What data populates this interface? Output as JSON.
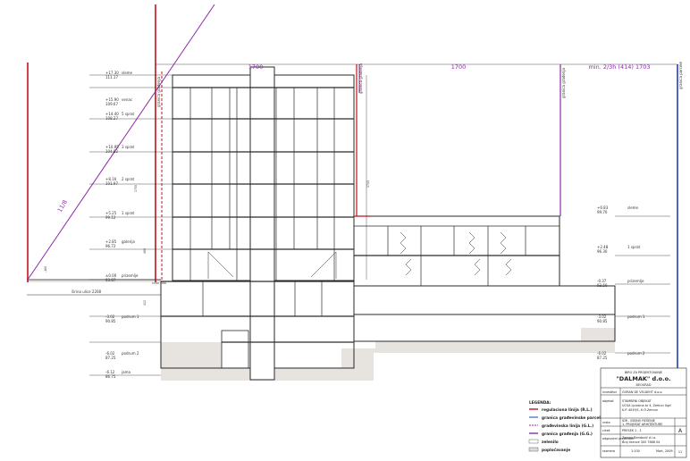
{
  "colors": {
    "line": "#2a2a2a",
    "red": "#c1121f",
    "purple": "#8e2aa8",
    "magenta": "#b0208a",
    "blue": "#1f3fb5",
    "ground": "#e7e3de",
    "grid": "#d9d9d9"
  },
  "dimensions": {
    "top_left": "1700",
    "top_right": "1700",
    "top_far_right": "min. 2/3h (414)  1703",
    "diagonal_left": "11/8",
    "street_width": "širina ulice 2208"
  },
  "vertical_labels": {
    "granica_gradjenja_left": "granica građenja",
    "granica_gradjenja_right": "granica građenja",
    "granica_parcele": "granica parcele",
    "height_1": "1750",
    "height_2": "1745"
  },
  "levels_left": [
    {
      "elev": "+17.30",
      "abs": "111.17",
      "name": "sleme"
    },
    {
      "elev": "+15.90",
      "abs": "109.67",
      "name": "venac"
    },
    {
      "elev": "+14.40",
      "abs": "108.27",
      "name": "5 sprat"
    },
    {
      "elev": "+10.95",
      "abs": "104.82",
      "name": "3 sprat"
    },
    {
      "elev": "+8.16",
      "abs": "101.97",
      "name": "2 sprat"
    },
    {
      "elev": "+5.25",
      "abs": "99.12",
      "name": "1 sprat"
    },
    {
      "elev": "+2.85",
      "abs": "96.72",
      "name": "galerija"
    },
    {
      "elev": "±0.00",
      "abs": "93.87",
      "name": "prizemlje"
    },
    {
      "elev": "-3.02",
      "abs": "90.85",
      "name": "podrum 1"
    },
    {
      "elev": "-6.02",
      "abs": "87.25",
      "name": "podrum 2"
    },
    {
      "elev": "-6.12",
      "abs": "86.75",
      "name": "jama"
    }
  ],
  "levels_right": [
    {
      "elev": "+6.83",
      "abs": "99.70",
      "name": "sleme"
    },
    {
      "elev": "+2.48",
      "abs": "96.30",
      "name": "1 sprat"
    },
    {
      "elev": "-0.37",
      "abs": "93.50",
      "name": "prizemlje"
    },
    {
      "elev": "-3.02",
      "abs": "90.85",
      "name": "podrum 1"
    },
    {
      "elev": "-6.02",
      "abs": "87.25",
      "name": "podrum 2"
    }
  ],
  "annotations": {
    "nulta_kota": "nulta kota",
    "dim_480": "480",
    "dim_412": "412",
    "dim_160": "-160"
  },
  "legend": {
    "title": "LEGENDA:",
    "items": [
      "regulaciona linija (R.L.)",
      "granica građevinske parcele (G.P.)",
      "građevinska linija (G.L.)",
      "granica građenja (G.G.)",
      "zelenilo",
      "poploćavanje"
    ]
  },
  "title_block": {
    "header": "BIRO ZA PROJEKTOVANJE",
    "company": "\"DALMAK\" d.o.o.",
    "city": "BEOGRAD",
    "row1_label": "investitor",
    "row1_value": "GORAN DE VELDEHT d.o.o.",
    "row2_label": "objekat",
    "row2_value": "STAMBENI OBJEKAT",
    "row2_value2": "UCSA Ljubicna br 4, Zemun Ugd",
    "row2_value3": "K.P. 4039/1, K.O.Zemun",
    "row3_label": "vrsta",
    "row3_value": "IDR - IDEJNO REŠENJE",
    "row3_value2": "1. PROJEKAT ARHITEKTURE",
    "row4_label": "crtež",
    "row4_value": "PRESEK  1 - 1",
    "sheet_letter": "A",
    "row5_label": "odgovorni projektant",
    "row5_value": "Zorana Bandović d.i.a.",
    "row5_value2": "Broj licence   300 7868 04",
    "row6_label": "razmera",
    "row6_value": "1:100",
    "date": "Mart, 2009.",
    "sheet_no": "11"
  }
}
